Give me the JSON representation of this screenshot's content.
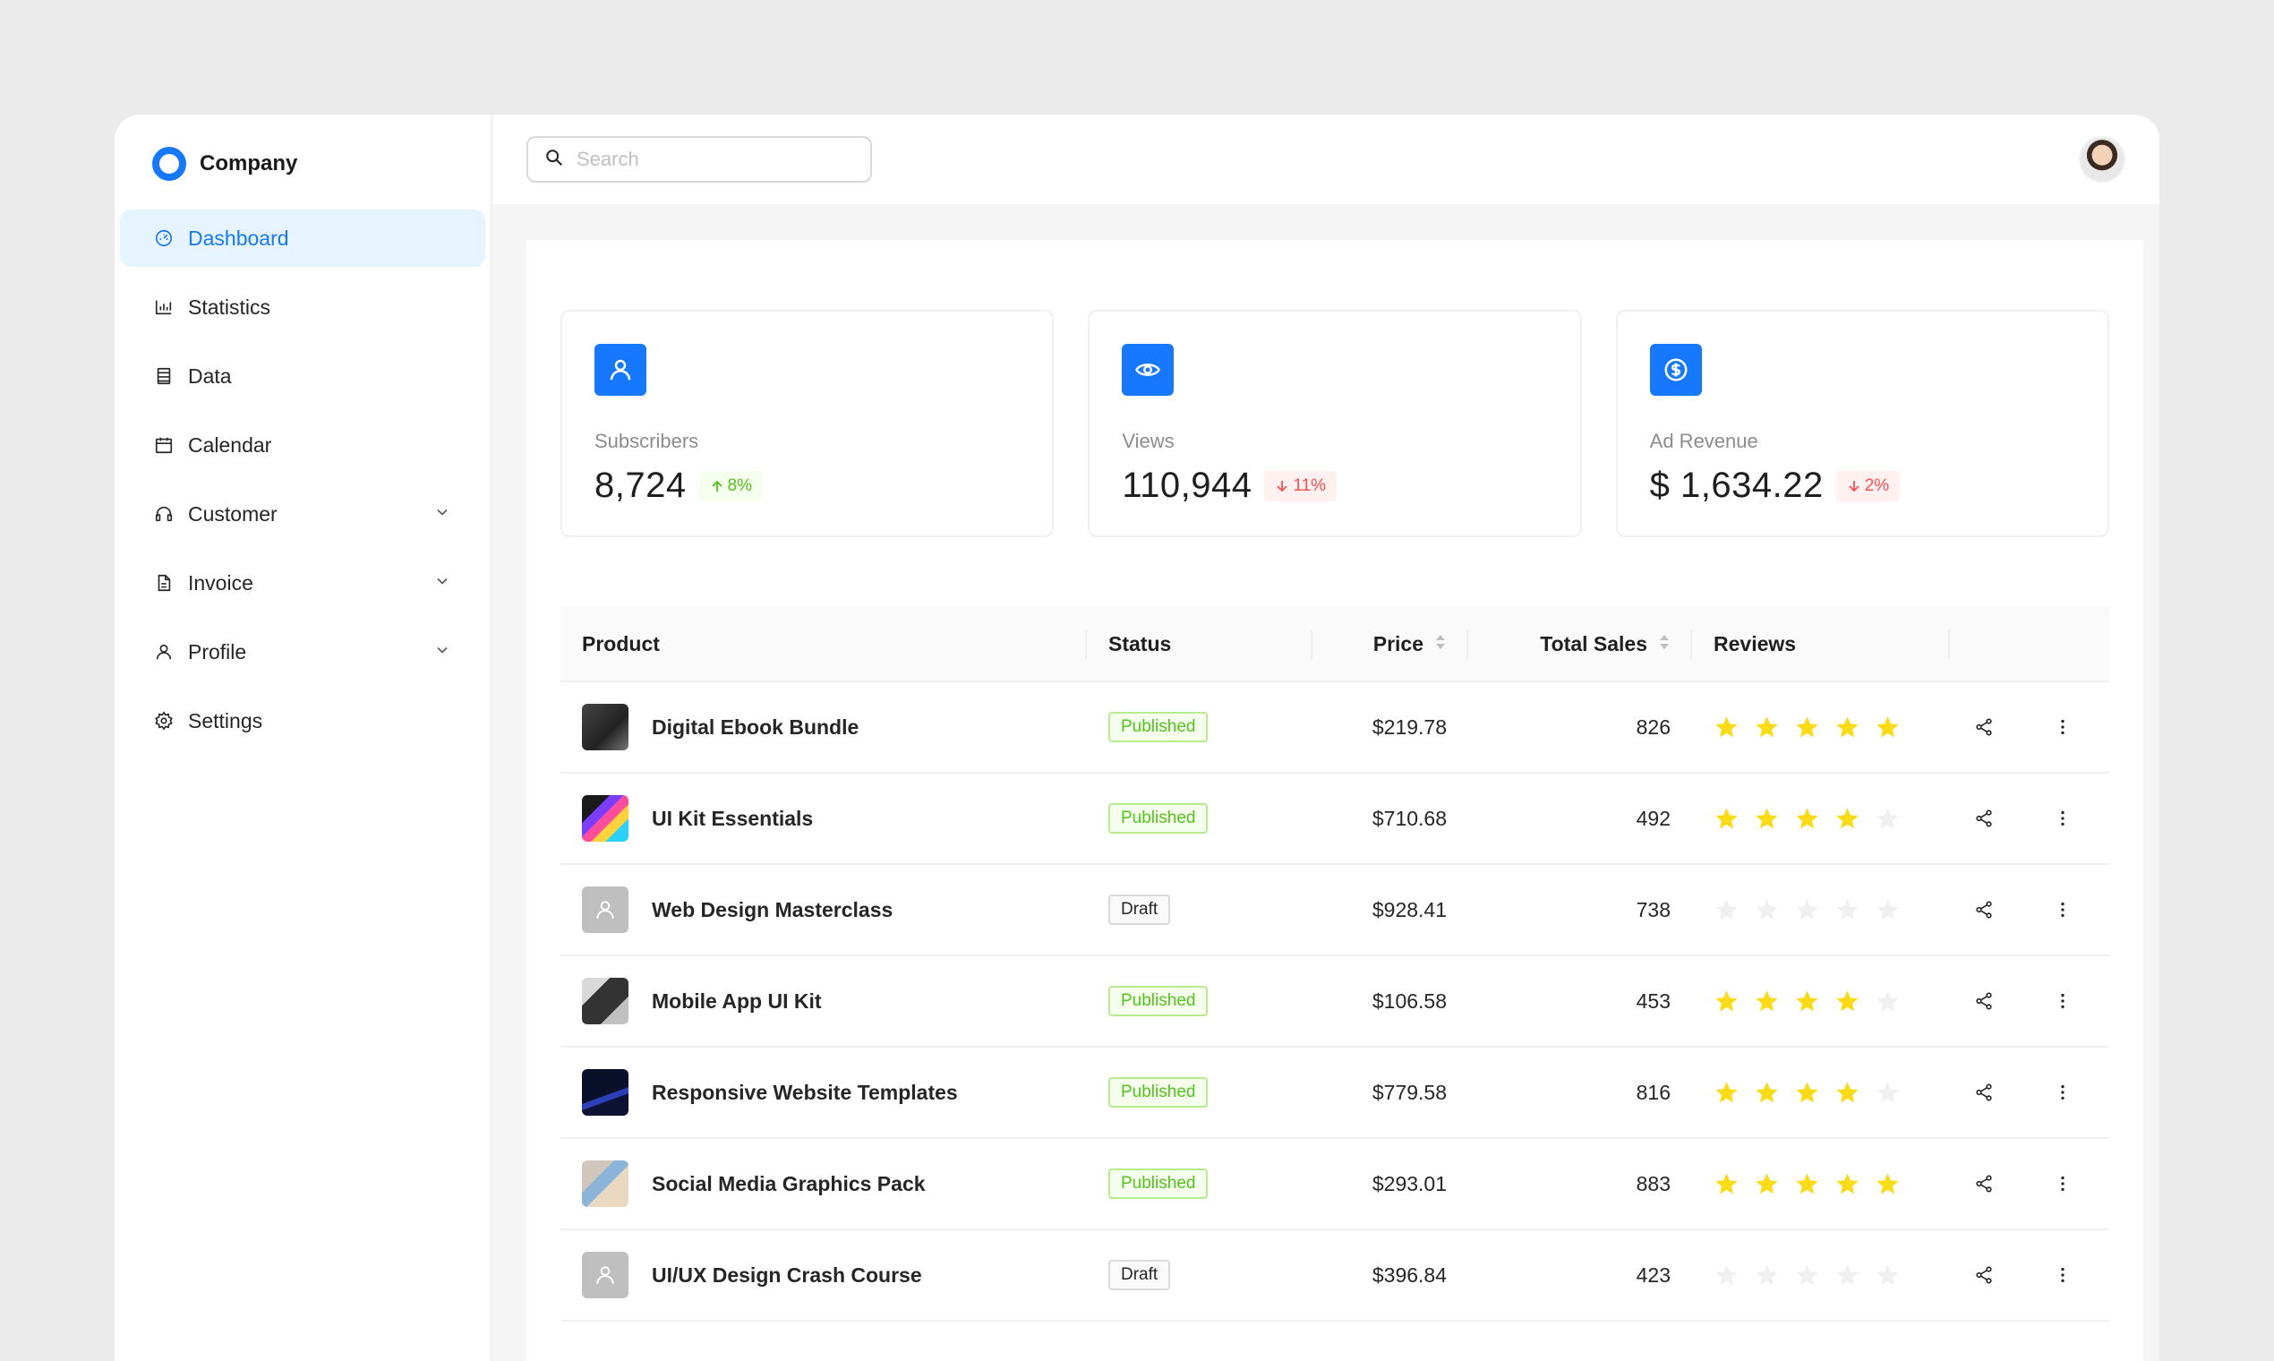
{
  "brand": {
    "name": "Company",
    "accent": "#1677ff"
  },
  "sidebar": {
    "items": [
      {
        "label": "Dashboard",
        "icon": "dashboard-icon",
        "active": true,
        "expandable": false
      },
      {
        "label": "Statistics",
        "icon": "bar-chart-icon",
        "active": false,
        "expandable": false
      },
      {
        "label": "Data",
        "icon": "database-icon",
        "active": false,
        "expandable": false
      },
      {
        "label": "Calendar",
        "icon": "calendar-icon",
        "active": false,
        "expandable": false
      },
      {
        "label": "Customer",
        "icon": "headset-icon",
        "active": false,
        "expandable": true
      },
      {
        "label": "Invoice",
        "icon": "file-icon",
        "active": false,
        "expandable": true
      },
      {
        "label": "Profile",
        "icon": "user-icon",
        "active": false,
        "expandable": true
      },
      {
        "label": "Settings",
        "icon": "gear-icon",
        "active": false,
        "expandable": false
      }
    ]
  },
  "search": {
    "placeholder": "Search",
    "value": ""
  },
  "stats": [
    {
      "label": "Subscribers",
      "value": "8,724",
      "change": "8%",
      "direction": "up",
      "icon": "user-icon"
    },
    {
      "label": "Views",
      "value": "110,944",
      "change": "11%",
      "direction": "down",
      "icon": "eye-icon"
    },
    {
      "label": "Ad Revenue",
      "value": "$ 1,634.22",
      "change": "2%",
      "direction": "down",
      "icon": "dollar-circle-icon"
    }
  ],
  "table": {
    "headers": {
      "product": "Product",
      "status": "Status",
      "price": "Price",
      "sales": "Total Sales",
      "reviews": "Reviews"
    },
    "rows": [
      {
        "product": "Digital Ebook Bundle",
        "thumb": "t-tablet",
        "status": "Published",
        "price": "$219.78",
        "sales": "826",
        "rating": 5
      },
      {
        "product": "UI Kit Essentials",
        "thumb": "t-phones",
        "status": "Published",
        "price": "$710.68",
        "sales": "492",
        "rating": 4
      },
      {
        "product": "Web Design Masterclass",
        "thumb": "t-placeholder",
        "status": "Draft",
        "price": "$928.41",
        "sales": "738",
        "rating": 0
      },
      {
        "product": "Mobile App UI Kit",
        "thumb": "t-mobile",
        "status": "Published",
        "price": "$106.58",
        "sales": "453",
        "rating": 4
      },
      {
        "product": "Responsive Website Templates",
        "thumb": "t-code",
        "status": "Published",
        "price": "$779.58",
        "sales": "816",
        "rating": 4
      },
      {
        "product": "Social Media Graphics Pack",
        "thumb": "t-desk",
        "status": "Published",
        "price": "$293.01",
        "sales": "883",
        "rating": 5
      },
      {
        "product": "UI/UX Design Crash Course",
        "thumb": "t-placeholder",
        "status": "Draft",
        "price": "$396.84",
        "sales": "423",
        "rating": 0
      }
    ]
  },
  "colors": {
    "star_on": "#fadb14",
    "star_off": "#f0f0f0",
    "published": "#52c41a",
    "down": "#ff4d4f"
  }
}
